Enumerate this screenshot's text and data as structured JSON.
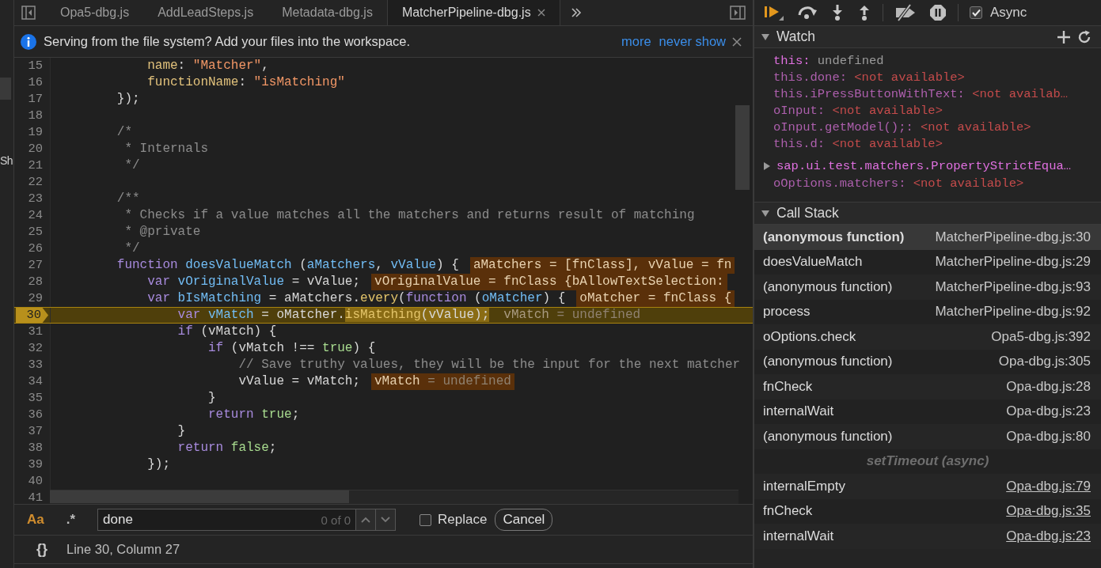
{
  "navigator_fragment": "Sh",
  "tabs": [
    {
      "label": "Opa5-dbg.js",
      "selected": false
    },
    {
      "label": "AddLeadSteps.js",
      "selected": false
    },
    {
      "label": "Metadata-dbg.js",
      "selected": false
    },
    {
      "label": "MatcherPipeline-dbg.js",
      "selected": true
    }
  ],
  "infobar": {
    "message": "Serving from the file system? Add your files into the workspace.",
    "links": [
      "more",
      "never show"
    ]
  },
  "editor": {
    "lines": [
      {
        "number": "15",
        "code": [
          {
            "kind": "prop",
            "text": "            name"
          },
          {
            "kind": "plain",
            "text": ": "
          },
          {
            "kind": "str",
            "text": "\"Matcher\""
          },
          {
            "kind": "plain",
            "text": ","
          }
        ]
      },
      {
        "number": "16",
        "code": [
          {
            "kind": "prop",
            "text": "            functionName"
          },
          {
            "kind": "plain",
            "text": ": "
          },
          {
            "kind": "str",
            "text": "\"isMatching\""
          }
        ]
      },
      {
        "number": "17",
        "code": [
          {
            "kind": "plain",
            "text": "        });"
          }
        ]
      },
      {
        "number": "18"
      },
      {
        "number": "19",
        "code": [
          {
            "kind": "cmt",
            "text": "        /*"
          }
        ]
      },
      {
        "number": "20",
        "code": [
          {
            "kind": "cmt",
            "text": "         * Internals"
          }
        ]
      },
      {
        "number": "21",
        "code": [
          {
            "kind": "cmt",
            "text": "         */"
          }
        ]
      },
      {
        "number": "22"
      },
      {
        "number": "23",
        "code": [
          {
            "kind": "cmt",
            "text": "        /**"
          }
        ]
      },
      {
        "number": "24",
        "code": [
          {
            "kind": "cmt",
            "text": "         * Checks if a value matches all the matchers and returns result of matching"
          }
        ]
      },
      {
        "number": "25",
        "code": [
          {
            "kind": "cmt",
            "text": "         * @private"
          }
        ]
      },
      {
        "number": "26",
        "code": [
          {
            "kind": "cmt",
            "text": "         */"
          }
        ]
      },
      {
        "number": "27",
        "code": [
          {
            "kind": "kw",
            "text": "        function"
          },
          {
            "kind": "def",
            "text": " doesValueMatch"
          },
          {
            "kind": "plain",
            "text": " ("
          },
          {
            "kind": "def",
            "text": "aMatchers"
          },
          {
            "kind": "plain",
            "text": ", "
          },
          {
            "kind": "def",
            "text": "vValue"
          },
          {
            "kind": "plain",
            "text": ") {"
          }
        ],
        "inline": [
          {
            "kind": "name",
            "text": "aMatchers = [fnClass], vValue = fn"
          }
        ]
      },
      {
        "number": "28",
        "code": [
          {
            "kind": "kw",
            "text": "            var"
          },
          {
            "kind": "def",
            "text": " vOriginalValue"
          },
          {
            "kind": "plain",
            "text": " = vValue;"
          }
        ],
        "inline": [
          {
            "kind": "name",
            "text": "vOriginalValue = fnClass {bAllowTextSelection:"
          }
        ]
      },
      {
        "number": "29",
        "code": [
          {
            "kind": "kw",
            "text": "            var"
          },
          {
            "kind": "def",
            "text": " bIsMatching"
          },
          {
            "kind": "plain",
            "text": " = aMatchers."
          },
          {
            "kind": "call",
            "text": "every"
          },
          {
            "kind": "plain",
            "text": "("
          },
          {
            "kind": "kw",
            "text": "function"
          },
          {
            "kind": "plain",
            "text": " ("
          },
          {
            "kind": "def",
            "text": "oMatcher"
          },
          {
            "kind": "plain",
            "text": ") {"
          }
        ],
        "inline": [
          {
            "kind": "name",
            "text": "oMatcher = fnClass {"
          }
        ]
      },
      {
        "number": "30",
        "current": true,
        "code": [
          {
            "kind": "kw",
            "text": "                var"
          },
          {
            "kind": "def",
            "text": " vMatch"
          },
          {
            "kind": "plain",
            "text": " = oMatcher."
          },
          {
            "kind": "call",
            "text": "isMatching",
            "paused": true
          },
          {
            "kind": "plain",
            "text": "(vValue);",
            "paused": true
          }
        ],
        "inline": [
          {
            "kind": "name",
            "text": "vMatch"
          },
          {
            "kind": "dim",
            "text": " = undefined"
          }
        ]
      },
      {
        "number": "31",
        "code": [
          {
            "kind": "kw",
            "text": "                if"
          },
          {
            "kind": "plain",
            "text": " (vMatch) {"
          }
        ]
      },
      {
        "number": "32",
        "code": [
          {
            "kind": "kw",
            "text": "                    if"
          },
          {
            "kind": "plain",
            "text": " (vMatch !== "
          },
          {
            "kind": "lit",
            "text": "true"
          },
          {
            "kind": "plain",
            "text": ") {"
          }
        ]
      },
      {
        "number": "33",
        "code": [
          {
            "kind": "cmt",
            "text": "                        // Save truthy values, they will be the input for the next matcher"
          }
        ]
      },
      {
        "number": "34",
        "code": [
          {
            "kind": "plain",
            "text": "                        vValue = vMatch;"
          }
        ],
        "inline": [
          {
            "kind": "name",
            "text": "vMatch"
          },
          {
            "kind": "dim",
            "text": " = undefined"
          }
        ]
      },
      {
        "number": "35",
        "code": [
          {
            "kind": "plain",
            "text": "                    }"
          }
        ]
      },
      {
        "number": "36",
        "code": [
          {
            "kind": "kw",
            "text": "                    return"
          },
          {
            "kind": "lit",
            "text": " true"
          },
          {
            "kind": "plain",
            "text": ";"
          }
        ]
      },
      {
        "number": "37",
        "code": [
          {
            "kind": "plain",
            "text": "                }"
          }
        ]
      },
      {
        "number": "38",
        "code": [
          {
            "kind": "kw",
            "text": "                return"
          },
          {
            "kind": "lit",
            "text": " false"
          },
          {
            "kind": "plain",
            "text": ";"
          }
        ]
      },
      {
        "number": "39",
        "code": [
          {
            "kind": "plain",
            "text": "            });"
          }
        ]
      },
      {
        "number": "40"
      },
      {
        "number": "41"
      }
    ]
  },
  "search": {
    "match_case": {
      "label": "Aa",
      "on": true
    },
    "regex": {
      "label": ".*",
      "on": false
    },
    "value": "done",
    "count": "0 of 0",
    "replace": {
      "label": "Replace",
      "checked": false
    },
    "cancel": "Cancel"
  },
  "status": {
    "format": "{}",
    "cursor": "Line 30, Column 27"
  },
  "debugger_toolbar": {
    "async": {
      "label": "Async",
      "checked": true
    }
  },
  "watch": {
    "title": "Watch",
    "expanded": true,
    "items": [
      {
        "kind": "value",
        "label": "this:",
        "value": "undefined",
        "available": true
      },
      {
        "kind": "value",
        "label": "this.done:",
        "value": "<not available>",
        "available": false
      },
      {
        "kind": "value",
        "label": "this.iPressButtonWithText:",
        "value": "<not availab…",
        "available": false
      },
      {
        "kind": "value",
        "label": "oInput:",
        "value": "<not available>",
        "available": false
      },
      {
        "kind": "value",
        "label": "oInput.getModel();:",
        "value": "<not available>",
        "available": false
      },
      {
        "kind": "value",
        "label": "this.d:",
        "value": "<not available>",
        "available": false
      },
      {
        "kind": "object",
        "label": "sap.ui.test.matchers.PropertyStrictEqua…",
        "expanded": false
      },
      {
        "kind": "value",
        "label": "oOptions.matchers:",
        "value": "<not available>",
        "available": false
      }
    ]
  },
  "call_stack": {
    "title": "Call Stack",
    "expanded": true,
    "frames": [
      {
        "kind": "frame",
        "function": "(anonymous function)",
        "location": "MatcherPipeline-dbg.js:30",
        "selected": true,
        "linked": false
      },
      {
        "kind": "frame",
        "function": "doesValueMatch",
        "location": "MatcherPipeline-dbg.js:29",
        "selected": false,
        "linked": false
      },
      {
        "kind": "frame",
        "function": "(anonymous function)",
        "location": "MatcherPipeline-dbg.js:93",
        "selected": false,
        "linked": false
      },
      {
        "kind": "frame",
        "function": "process",
        "location": "MatcherPipeline-dbg.js:92",
        "selected": false,
        "linked": false
      },
      {
        "kind": "frame",
        "function": "oOptions.check",
        "location": "Opa5-dbg.js:392",
        "selected": false,
        "linked": false
      },
      {
        "kind": "frame",
        "function": "(anonymous function)",
        "location": "Opa-dbg.js:305",
        "selected": false,
        "linked": false
      },
      {
        "kind": "frame",
        "function": "fnCheck",
        "location": "Opa-dbg.js:28",
        "selected": false,
        "linked": false
      },
      {
        "kind": "frame",
        "function": "internalWait",
        "location": "Opa-dbg.js:23",
        "selected": false,
        "linked": false
      },
      {
        "kind": "frame",
        "function": "(anonymous function)",
        "location": "Opa-dbg.js:80",
        "selected": false,
        "linked": false
      },
      {
        "kind": "async",
        "label": "setTimeout (async)"
      },
      {
        "kind": "frame",
        "function": "internalEmpty",
        "location": "Opa-dbg.js:79",
        "selected": false,
        "linked": true
      },
      {
        "kind": "frame",
        "function": "fnCheck",
        "location": "Opa-dbg.js:35",
        "selected": false,
        "linked": true
      },
      {
        "kind": "frame",
        "function": "internalWait",
        "location": "Opa-dbg.js:23",
        "selected": false,
        "linked": true
      }
    ]
  }
}
